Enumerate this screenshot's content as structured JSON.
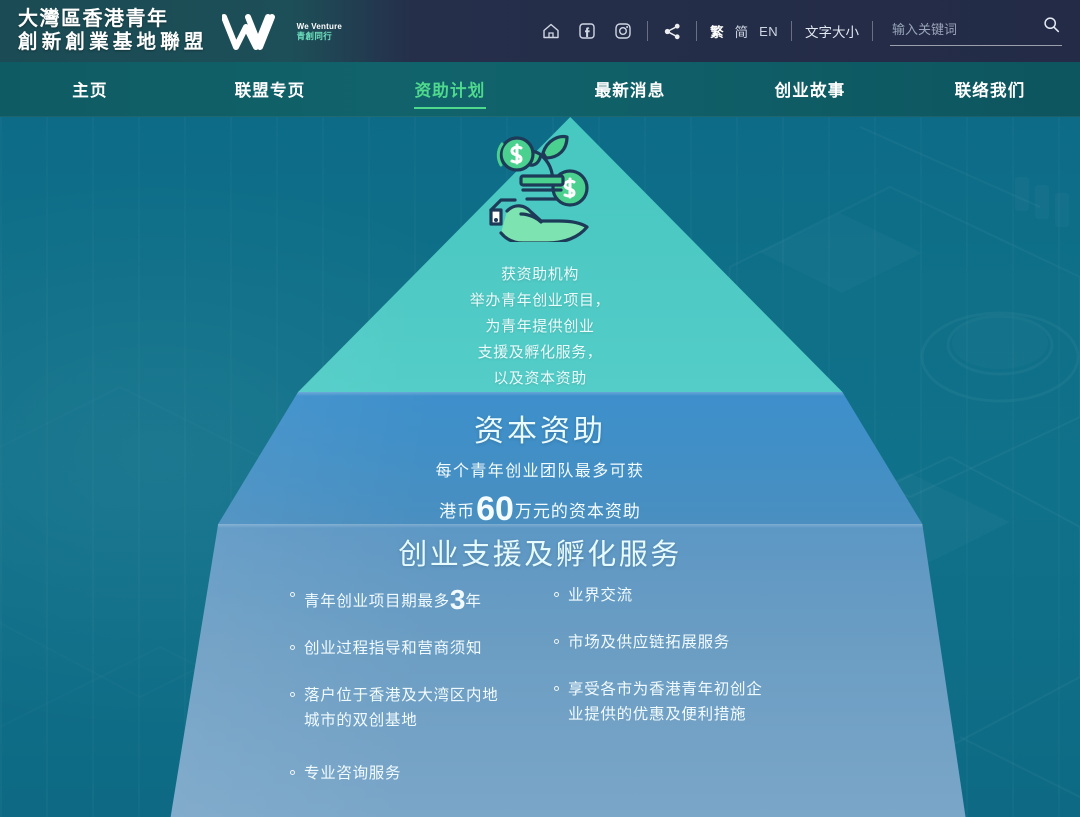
{
  "header": {
    "brand": {
      "line1": "大灣區香港青年",
      "line2": "創新創業基地聯盟",
      "logo_en": "We Venture",
      "logo_cn": "青創同行"
    },
    "icons": [
      {
        "name": "home-icon",
        "title": "主页"
      },
      {
        "name": "facebook-icon",
        "title": "Facebook"
      },
      {
        "name": "instagram-icon",
        "title": "Instagram"
      },
      {
        "name": "share-icon",
        "title": "分享"
      }
    ],
    "languages": [
      {
        "label": "繁",
        "active": true
      },
      {
        "label": "简",
        "active": false
      },
      {
        "label": "EN",
        "active": false
      }
    ],
    "font_size_label": "文字大小",
    "search": {
      "placeholder": "输入关键词",
      "value": "",
      "icon": "search-icon"
    }
  },
  "nav": {
    "items": [
      {
        "label": "主页",
        "active": false
      },
      {
        "label": "联盟专页",
        "active": false
      },
      {
        "label": "资助计划",
        "active": true
      },
      {
        "label": "最新消息",
        "active": false
      },
      {
        "label": "创业故事",
        "active": false
      },
      {
        "label": "联络我们",
        "active": false
      }
    ],
    "active_color": "#4fd98d"
  },
  "hero": {
    "illustration": "hand-with-coins-and-plant-icon",
    "tier1": {
      "color": "#4ec9c4",
      "lines": [
        "获资助机构",
        "举办青年创业项目，",
        "为青年提供创业",
        "支援及孵化服务，",
        "以及资本资助"
      ]
    },
    "tier2": {
      "color": "#418fc6",
      "title": "资本资助",
      "subtitle": "每个青年创业团队最多可获",
      "amount_prefix": "港币",
      "amount_number": "60",
      "amount_suffix": "万元的资本资助"
    },
    "tier3": {
      "color": "#6b9dc3",
      "title": "创业支援及孵化服务",
      "left_items": [
        {
          "pre": "青年创业项目期最多",
          "num": "3",
          "post": "年"
        },
        {
          "pre": "创业过程指导和营商须知",
          "num": "",
          "post": ""
        },
        {
          "pre": "落户位于香港及大湾区内地\n城市的双创基地",
          "num": "",
          "post": ""
        },
        {
          "pre": "专业咨询服务",
          "num": "",
          "post": ""
        }
      ],
      "right_items": [
        {
          "pre": "业界交流",
          "num": "",
          "post": ""
        },
        {
          "pre": "市场及供应链拓展服务",
          "num": "",
          "post": ""
        },
        {
          "pre": "享受各市为香港青年初创企\n业提供的优惠及便利措施",
          "num": "",
          "post": ""
        }
      ]
    }
  }
}
